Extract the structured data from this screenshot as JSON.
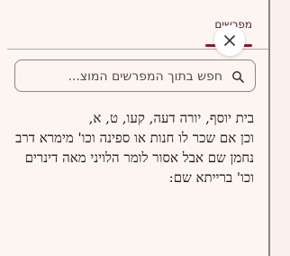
{
  "panel": {
    "tab_label": "מפרשים",
    "close_label": "×"
  },
  "search": {
    "placeholder": "חפש בתוך המפרשים המוצ...",
    "value": ""
  },
  "content": {
    "source": "בית יוסף, יורה דעה,  קעו, ט, א,",
    "body": "וכן אם שכר לו חנות או ספינה וכו' מימרא דרב נחמן שם אבל אסור לומר הלויני מאה דינרים וכו' ברייתא שם:"
  },
  "colors": {
    "accent": "#7a2030",
    "background": "#fdf5f2"
  },
  "icons": {
    "close": "close-icon",
    "search": "search-icon"
  }
}
